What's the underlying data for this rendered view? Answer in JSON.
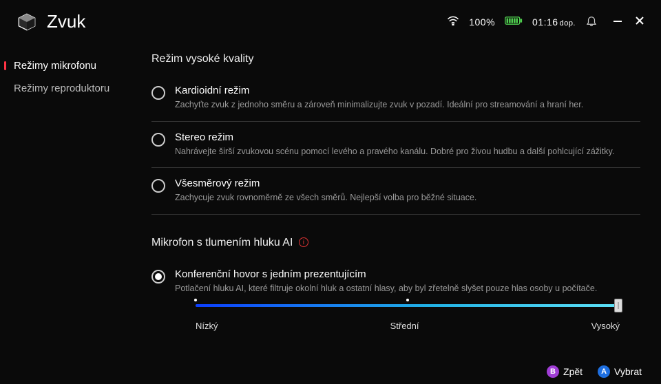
{
  "header": {
    "title": "Zvuk",
    "wifi_percent": "100%",
    "time": "01:16",
    "time_suffix": "dop."
  },
  "sidebar": {
    "items": [
      {
        "label": "Režimy mikrofonu",
        "active": true
      },
      {
        "label": "Režimy reproduktoru",
        "active": false
      }
    ]
  },
  "section1": {
    "title": "Režim vysoké kvality",
    "options": [
      {
        "title": "Kardioidní režim",
        "desc": "Zachyťte zvuk z jednoho směru a zároveň minimalizujte zvuk v pozadí. Ideální pro streamování a hraní her.",
        "selected": false
      },
      {
        "title": "Stereo režim",
        "desc": "Nahrávejte širší zvukovou scénu pomocí levého a pravého kanálu. Dobré pro živou hudbu a další pohlcující zážitky.",
        "selected": false
      },
      {
        "title": "Všesměrový režim",
        "desc": "Zachycuje zvuk rovnoměrně ze všech směrů. Nejlepší volba pro běžné situace.",
        "selected": false
      }
    ]
  },
  "section2": {
    "title": "Mikrofon s tlumením hluku AI",
    "option": {
      "title": "Konferenční hovor s jedním prezentujícím",
      "desc": "Potlačení hluku AI, které filtruje okolní hluk a ostatní hlasy, aby byl zřetelně slyšet pouze hlas osoby u počítače.",
      "selected": true
    },
    "slider": {
      "labels": [
        "Nízký",
        "Střední",
        "Vysoký"
      ],
      "value_index": 2
    }
  },
  "footer": {
    "back": "Zpět",
    "select": "Vybrat",
    "back_key": "B",
    "select_key": "A"
  }
}
